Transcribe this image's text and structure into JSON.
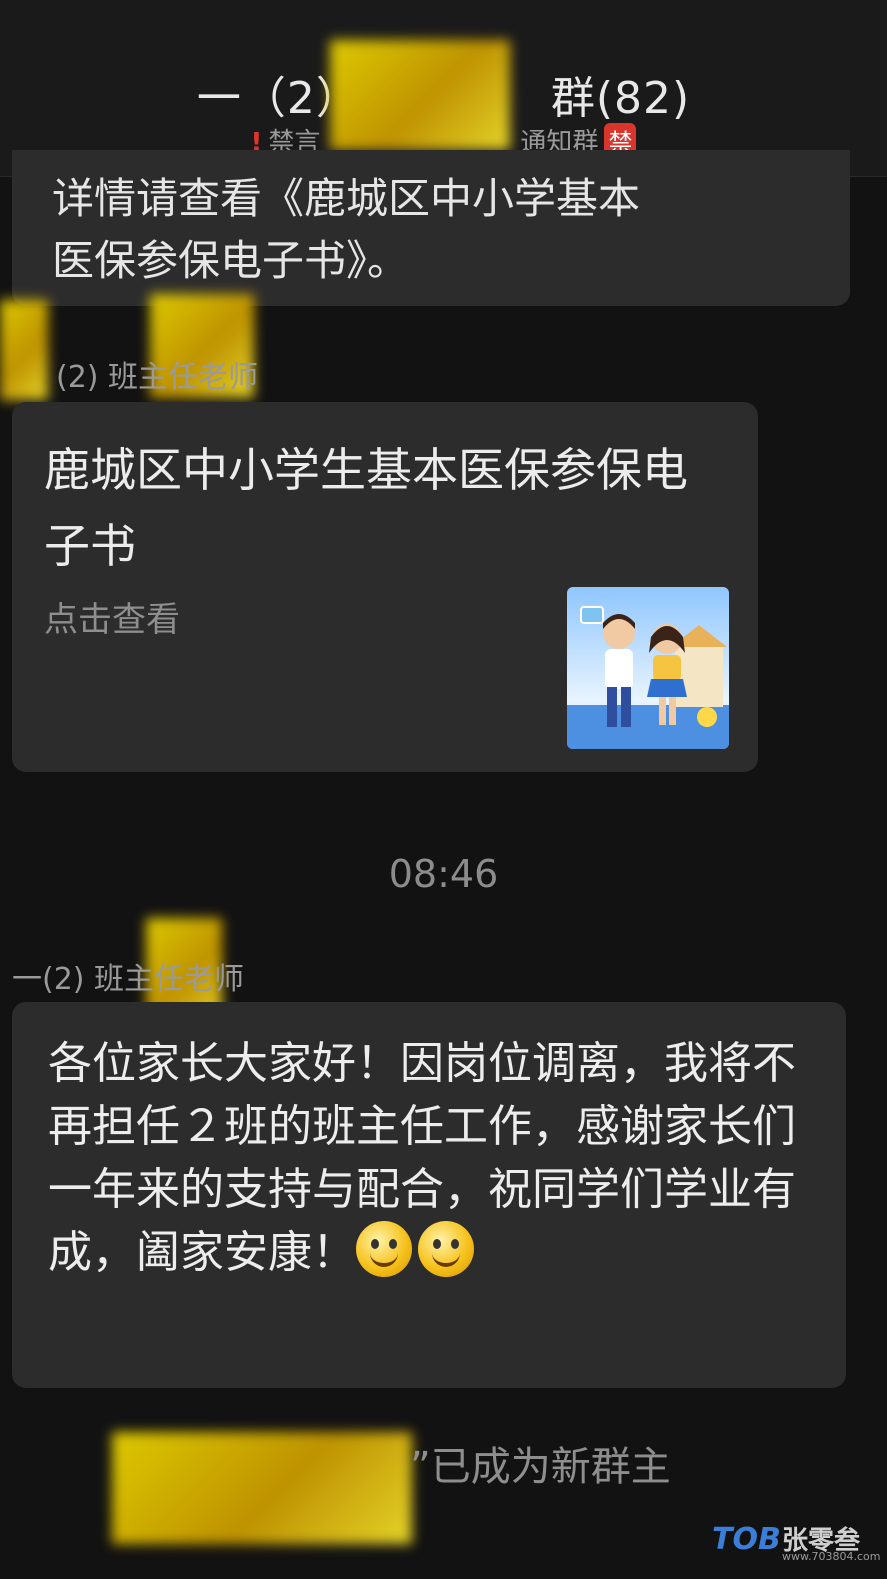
{
  "header": {
    "title_left": "一（2）",
    "title_right": "群(82)",
    "status_muted": "禁言",
    "group_type": "通知群",
    "ban_badge": "禁"
  },
  "messages": {
    "prev_bubble_line1": "详情请查看《鹿城区中小学基本",
    "prev_bubble_line2": "医保参保电子书》。",
    "card_sender": "(2) 班主任老师",
    "card_title": "鹿城区中小学生基本医保参保电子书",
    "card_action": "点击查看",
    "timestamp": "08:46",
    "msg_sender": "一(2) 班主任老师",
    "msg_text": "各位家长大家好！因岗位调离，我将不再担任２班的班主任工作，感谢家长们一年来的支持与配合，祝同学们学业有成，阖家安康！",
    "emoji": "smile-emoji",
    "owner_notice": "”已成为新群主"
  },
  "watermark": {
    "logo": "TOB",
    "name": "张零叁",
    "url": "www.703804.com"
  }
}
